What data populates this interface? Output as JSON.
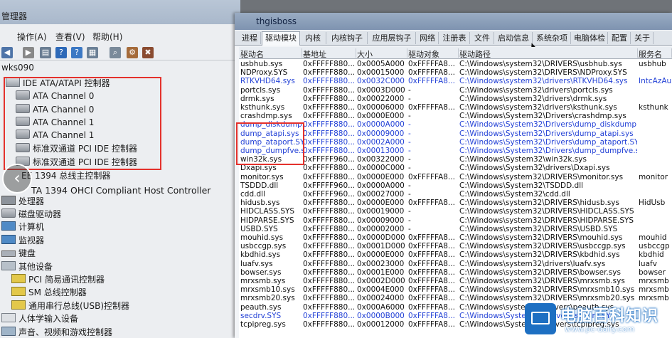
{
  "device_manager": {
    "title": "管理器",
    "menu": [
      "操作(A)",
      "查看(V)",
      "帮助(H)"
    ],
    "root": "wks090",
    "tree": [
      {
        "label": "IDE ATA/ATAPI 控制器",
        "level": 0,
        "icon": "ide-controller-icon"
      },
      {
        "label": "ATA Channel 0",
        "level": 1,
        "icon": "ide-channel-icon"
      },
      {
        "label": "ATA Channel 0",
        "level": 1,
        "icon": "ide-channel-icon"
      },
      {
        "label": "ATA Channel 1",
        "level": 1,
        "icon": "ide-channel-icon"
      },
      {
        "label": "ATA Channel 1",
        "level": 1,
        "icon": "ide-channel-icon"
      },
      {
        "label": "标准双通道 PCI IDE 控制器",
        "level": 1,
        "icon": "ide-channel-icon"
      },
      {
        "label": "标准双通道 PCI IDE 控制器",
        "level": 1,
        "icon": "ide-channel-icon"
      },
      {
        "label": "EE 1394 总线主控制器",
        "level": 0,
        "icon": "bus-controller-icon"
      },
      {
        "label": "TA 1394 OHCI Compliant Host Controller",
        "level": 1,
        "icon": "bus-controller-icon"
      },
      {
        "label": "处理器",
        "level": 0,
        "icon": "processor-icon"
      },
      {
        "label": "磁盘驱动器",
        "level": 0,
        "icon": "disk-drive-icon"
      },
      {
        "label": "计算机",
        "level": 0,
        "icon": "computer-icon"
      },
      {
        "label": "监视器",
        "level": 0,
        "icon": "monitor-icon"
      },
      {
        "label": "键盘",
        "level": 0,
        "icon": "keyboard-icon"
      },
      {
        "label": "其他设备",
        "level": 0,
        "icon": "other-devices-icon"
      },
      {
        "label": "PCI 简易通讯控制器",
        "level": 1,
        "icon": "warning-device-icon"
      },
      {
        "label": "SM 总线控制器",
        "level": 1,
        "icon": "warning-device-icon"
      },
      {
        "label": "通用串行总线(USB)控制器",
        "level": 1,
        "icon": "warning-device-icon"
      },
      {
        "label": "人体学输入设备",
        "level": 0,
        "icon": "hid-icon"
      },
      {
        "label": "声音、视频和游戏控制器",
        "level": 0,
        "icon": "sound-icon"
      }
    ]
  },
  "ark": {
    "title": "thgisboss",
    "tabs": [
      "进程",
      "驱动模块",
      "内核",
      "内核钩子",
      "应用层钩子",
      "网络",
      "注册表",
      "文件",
      "启动信息",
      "系统杂项",
      "电脑体检",
      "配置",
      "关于"
    ],
    "active_tab": "驱动模块",
    "columns": [
      "驱动名",
      "基地址",
      "大小",
      "驱动对象",
      "驱动路径",
      "服务名"
    ],
    "rows": [
      {
        "name": "usbhub.sys",
        "base": "0xFFFFF880...",
        "size": "0x0005A000",
        "obj": "0xFFFFFA8...",
        "path": "C:\\Windows\\system32\\DRIVERS\\usbhub.sys",
        "svc": "usbhub",
        "blue": false
      },
      {
        "name": "NDProxy.SYS",
        "base": "0xFFFFF880...",
        "size": "0x00015000",
        "obj": "0xFFFFFA8...",
        "path": "C:\\Windows\\system32\\DRIVERS\\NDProxy.SYS",
        "svc": "",
        "blue": false
      },
      {
        "name": "RTKVHD64.sys",
        "base": "0xFFFFF880...",
        "size": "0x0032C000",
        "obj": "0xFFFFFA8...",
        "path": "C:\\Windows\\system32\\drivers\\RTKVHD64.sys",
        "svc": "IntcAzAu...",
        "blue": true
      },
      {
        "name": "portcls.sys",
        "base": "0xFFFFF880...",
        "size": "0x0003D000",
        "obj": "-",
        "path": "C:\\Windows\\system32\\drivers\\portcls.sys",
        "svc": "",
        "blue": false
      },
      {
        "name": "drmk.sys",
        "base": "0xFFFFF880...",
        "size": "0x00022000",
        "obj": "-",
        "path": "C:\\Windows\\system32\\drivers\\drmk.sys",
        "svc": "",
        "blue": false
      },
      {
        "name": "ksthunk.sys",
        "base": "0xFFFFF880...",
        "size": "0x00006000",
        "obj": "0xFFFFFA8...",
        "path": "C:\\Windows\\system32\\drivers\\ksthunk.sys",
        "svc": "ksthunk",
        "blue": false
      },
      {
        "name": "crashdmp.sys",
        "base": "0xFFFFF880...",
        "size": "0x0000E000",
        "obj": "-",
        "path": "C:\\Windows\\System32\\Drivers\\crashdmp.sys",
        "svc": "",
        "blue": false
      },
      {
        "name": "dump_diskdump...",
        "base": "0xFFFFF880...",
        "size": "0x0000A000",
        "obj": "-",
        "path": "C:\\Windows\\System32\\Drivers\\dump_diskdump.sys",
        "svc": "",
        "blue": true
      },
      {
        "name": "dump_atapi.sys",
        "base": "0xFFFFF880...",
        "size": "0x00009000",
        "obj": "-",
        "path": "C:\\Windows\\System32\\Drivers\\dump_atapi.sys",
        "svc": "",
        "blue": true
      },
      {
        "name": "dump_ataport.SYS",
        "base": "0xFFFFF880...",
        "size": "0x0002A000",
        "obj": "-",
        "path": "C:\\Windows\\System32\\Drivers\\dump_ataport.SYS",
        "svc": "",
        "blue": true
      },
      {
        "name": "dump_dumpfve.sys",
        "base": "0xFFFFF880...",
        "size": "0x00013000",
        "obj": "-",
        "path": "C:\\Windows\\System32\\Drivers\\dump_dumpfve.sys",
        "svc": "",
        "blue": true
      },
      {
        "name": "win32k.sys",
        "base": "0xFFFFF960...",
        "size": "0x00322000",
        "obj": "-",
        "path": "C:\\Windows\\System32\\win32k.sys",
        "svc": "",
        "blue": false
      },
      {
        "name": "Dxapi.sys",
        "base": "0xFFFFF880...",
        "size": "0x0000C000",
        "obj": "-",
        "path": "C:\\Windows\\System32\\drivers\\Dxapi.sys",
        "svc": "",
        "blue": false
      },
      {
        "name": "monitor.sys",
        "base": "0xFFFFF880...",
        "size": "0x0000E000",
        "obj": "0xFFFFFA8...",
        "path": "C:\\Windows\\system32\\DRIVERS\\monitor.sys",
        "svc": "monitor",
        "blue": false
      },
      {
        "name": "TSDDD.dll",
        "base": "0xFFFFF960...",
        "size": "0x0000A000",
        "obj": "-",
        "path": "C:\\Windows\\System32\\TSDDD.dll",
        "svc": "",
        "blue": false
      },
      {
        "name": "cdd.dll",
        "base": "0xFFFFF960...",
        "size": "0x00027000",
        "obj": "-",
        "path": "C:\\Windows\\System32\\cdd.dll",
        "svc": "",
        "blue": false
      },
      {
        "name": "hidusb.sys",
        "base": "0xFFFFF880...",
        "size": "0x0000E000",
        "obj": "0xFFFFFA8...",
        "path": "C:\\Windows\\system32\\DRIVERS\\hidusb.sys",
        "svc": "HidUsb",
        "blue": false
      },
      {
        "name": "HIDCLASS.SYS",
        "base": "0xFFFFF880...",
        "size": "0x00019000",
        "obj": "-",
        "path": "C:\\Windows\\system32\\DRIVERS\\HIDCLASS.SYS",
        "svc": "",
        "blue": false
      },
      {
        "name": "HIDPARSE.SYS",
        "base": "0xFFFFF880...",
        "size": "0x00009000",
        "obj": "-",
        "path": "C:\\Windows\\system32\\DRIVERS\\HIDPARSE.SYS",
        "svc": "",
        "blue": false
      },
      {
        "name": "USBD.SYS",
        "base": "0xFFFFF880...",
        "size": "0x00002000",
        "obj": "-",
        "path": "C:\\Windows\\system32\\DRIVERS\\USBD.SYS",
        "svc": "",
        "blue": false
      },
      {
        "name": "mouhid.sys",
        "base": "0xFFFFF880...",
        "size": "0x0000D000",
        "obj": "0xFFFFFA8...",
        "path": "C:\\Windows\\system32\\DRIVERS\\mouhid.sys",
        "svc": "mouhid",
        "blue": false
      },
      {
        "name": "usbccgp.sys",
        "base": "0xFFFFF880...",
        "size": "0x0001D000",
        "obj": "0xFFFFFA8...",
        "path": "C:\\Windows\\system32\\DRIVERS\\usbccgp.sys",
        "svc": "usbccgp",
        "blue": false
      },
      {
        "name": "kbdhid.sys",
        "base": "0xFFFFF880...",
        "size": "0x0000E000",
        "obj": "0xFFFFFA8...",
        "path": "C:\\Windows\\system32\\DRIVERS\\kbdhid.sys",
        "svc": "kbdhid",
        "blue": false
      },
      {
        "name": "luafv.sys",
        "base": "0xFFFFF880...",
        "size": "0x00023000",
        "obj": "0xFFFFFA8...",
        "path": "C:\\Windows\\system32\\drivers\\luafv.sys",
        "svc": "luafv",
        "blue": false
      },
      {
        "name": "bowser.sys",
        "base": "0xFFFFF880...",
        "size": "0x0001E000",
        "obj": "0xFFFFFA8...",
        "path": "C:\\Windows\\system32\\DRIVERS\\bowser.sys",
        "svc": "bowser",
        "blue": false
      },
      {
        "name": "mrxsmb.sys",
        "base": "0xFFFFF880...",
        "size": "0x0002D000",
        "obj": "0xFFFFFA8...",
        "path": "C:\\Windows\\system32\\DRIVERS\\mrxsmb.sys",
        "svc": "mrxsmb",
        "blue": false
      },
      {
        "name": "mrxsmb10.sys",
        "base": "0xFFFFF880...",
        "size": "0x0004E000",
        "obj": "0xFFFFFA8...",
        "path": "C:\\Windows\\system32\\DRIVERS\\mrxsmb10.sys",
        "svc": "mrxsmb",
        "blue": false
      },
      {
        "name": "mrxsmb20.sys",
        "base": "0xFFFFF880...",
        "size": "0x00024000",
        "obj": "0xFFFFFA8...",
        "path": "C:\\Windows\\system32\\DRIVERS\\mrxsmb20.sys",
        "svc": "mrxsmb",
        "blue": false
      },
      {
        "name": "peauth.sys",
        "base": "0xFFFFF880...",
        "size": "0x000A6000",
        "obj": "0xFFFFFA8...",
        "path": "C:\\Windows\\system32\\drivers\\peauth.sys",
        "svc": "",
        "blue": false
      },
      {
        "name": "secdrv.SYS",
        "base": "0xFFFFF880...",
        "size": "0x0000B000",
        "obj": "0xFFFFFA8...",
        "path": "C:\\Windows\\System32\\Drivers\\secdrv.SYS",
        "svc": "",
        "blue": true
      },
      {
        "name": "tcpipreg.sys",
        "base": "0xFFFFF880...",
        "size": "0x00012000",
        "obj": "0xFFFFFA8...",
        "path": "C:\\Windows\\System32\\drivers\\tcpipreg.sys",
        "svc": "",
        "blue": false
      }
    ]
  },
  "watermark": {
    "title": "电脑百科知识",
    "url": "www.pc-daily.com"
  }
}
